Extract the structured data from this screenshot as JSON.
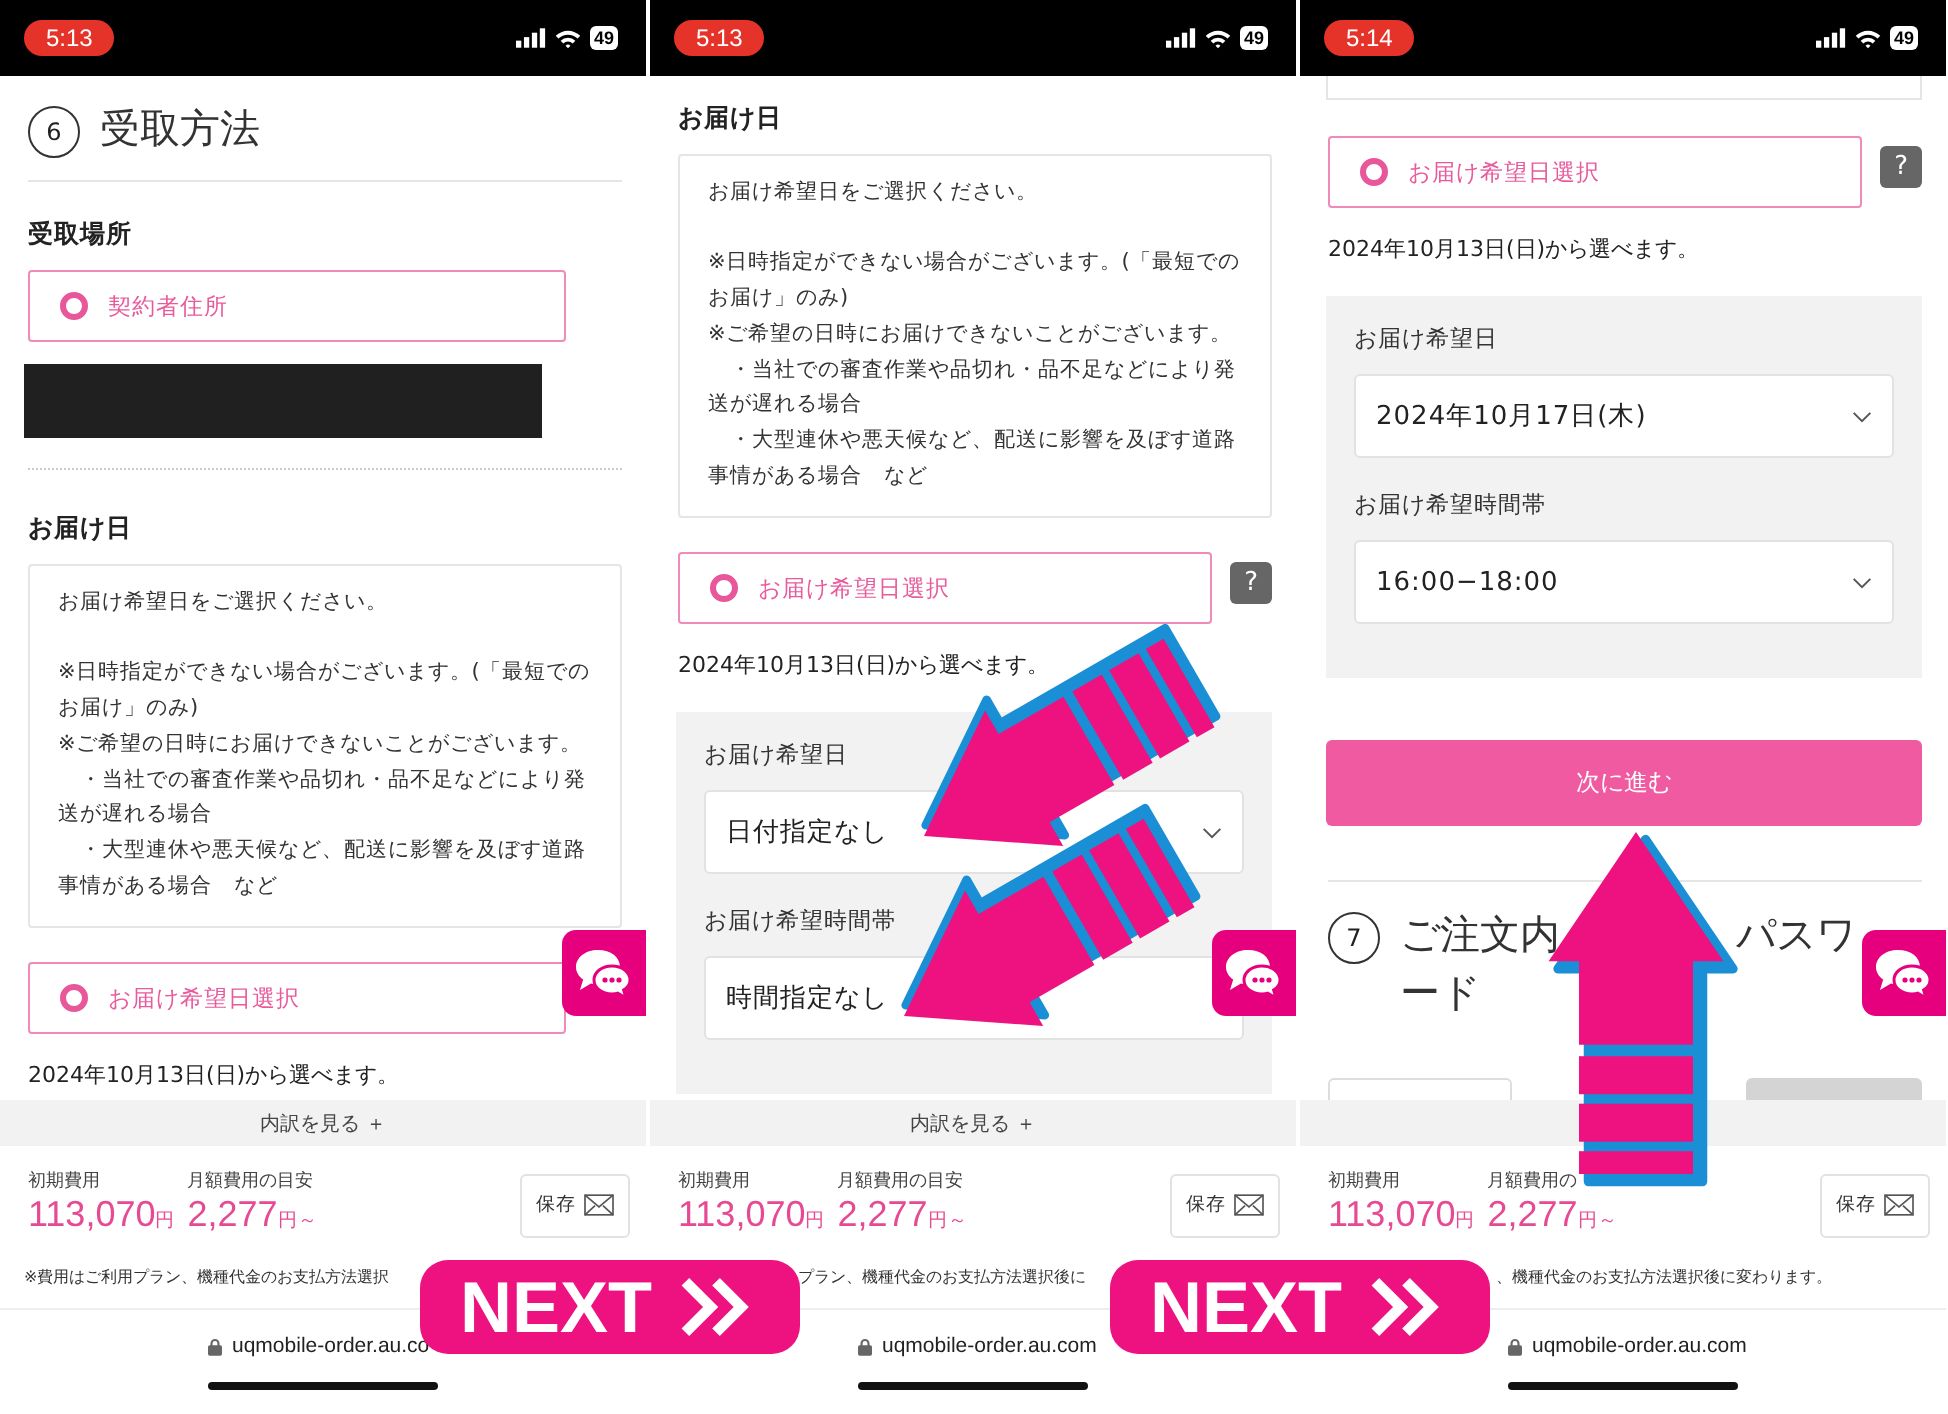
{
  "panels": [
    {
      "time": "5:13",
      "battery": "49",
      "chat_button": true,
      "blocks": [
        {
          "kind": "step",
          "number": "6",
          "title_parts": [
            "受取方法"
          ]
        },
        {
          "kind": "label",
          "text": "受取場所"
        },
        {
          "kind": "radio",
          "text": "契約者住所"
        },
        {
          "kind": "redacted"
        },
        {
          "kind": "divider"
        },
        {
          "kind": "label",
          "text": "お届け日"
        },
        {
          "kind": "notice",
          "paragraphs": [
            [
              "お届け希望日をご選択ください。"
            ],
            [
              "※日時指定ができない場合がございます。(「最短でのお届け」のみ)",
              "※ご希望の日時にお届けできないことがございます。",
              "　・当社での審査作業や品切れ・品不足などにより発送が遅れる場合",
              "　・大型連休や悪天候など、配送に影響を及ぼす道路事情がある場合　など"
            ]
          ]
        },
        {
          "kind": "radio",
          "text": "お届け希望日選択"
        },
        {
          "kind": "note",
          "text": "2024年10月13日(日)から選べます。"
        }
      ],
      "footer": {
        "breakdown": "内訳を見る ＋",
        "fees": [
          {
            "label": "初期費用",
            "amount": "113,070",
            "unit": "円"
          },
          {
            "label": "月額費用の目安",
            "amount": "2,277",
            "unit": "円～"
          }
        ],
        "save": "保存",
        "disclaimer": "※費用はご利用プラン、機種代金のお支払方法選択",
        "url": "uqmobile-order.au.co"
      }
    },
    {
      "time": "5:13",
      "battery": "49",
      "chat_button": true,
      "blocks": [
        {
          "kind": "label",
          "text": "お届け日"
        },
        {
          "kind": "notice",
          "paragraphs": [
            [
              "お届け希望日をご選択ください。"
            ],
            [
              "※日時指定ができない場合がございます。(「最短でのお届け」のみ)",
              "※ご希望の日時にお届けできないことがございます。",
              "　・当社での審査作業や品切れ・品不足などにより発送が遅れる場合",
              "　・大型連休や悪天候など、配送に影響を及ぼす道路事情がある場合　など"
            ]
          ]
        },
        {
          "kind": "radio",
          "text": "お届け希望日選択",
          "help": "?"
        },
        {
          "kind": "note",
          "text": "2024年10月13日(日)から選べます。"
        },
        {
          "kind": "selects",
          "fields": [
            {
              "label": "お届け希望日",
              "value": "日付指定なし",
              "caret": true
            },
            {
              "label": "お届け希望時間帯",
              "value": "時間指定なし",
              "caret": false
            }
          ]
        }
      ],
      "footer": {
        "breakdown": "内訳を見る ＋",
        "fees": [
          {
            "label": "初期費用",
            "amount": "113,070",
            "unit": "円"
          },
          {
            "label": "月額費用の目安",
            "amount": "2,277",
            "unit": "円～"
          }
        ],
        "save": "保存",
        "disclaimer": "プラン、機種代金のお支払方法選択後に",
        "url": "uqmobile-order.au.com"
      }
    },
    {
      "time": "5:14",
      "battery": "49",
      "chat_button": true,
      "blocks": [
        {
          "kind": "box_end"
        },
        {
          "kind": "radio",
          "text": "お届け希望日選択",
          "help": "?"
        },
        {
          "kind": "note",
          "text": "2024年10月13日(日)から選べます。"
        },
        {
          "kind": "selects",
          "fields": [
            {
              "label": "お届け希望日",
              "value": "2024年10月17日(木)",
              "caret": true
            },
            {
              "label": "お届け希望時間帯",
              "value": "16:00−18:00",
              "caret": true
            }
          ]
        },
        {
          "kind": "button",
          "text": "次に進む"
        },
        {
          "kind": "divider"
        },
        {
          "kind": "step",
          "number": "7",
          "title_parts": [
            "ご注文内",
            "パスワ",
            "ード"
          ]
        },
        {
          "kind": "partial_inputs"
        }
      ],
      "footer": {
        "fees": [
          {
            "label": "初期費用",
            "amount": "113,070",
            "unit": "円"
          },
          {
            "label": "月額費用の",
            "amount": "2,277",
            "unit": "円～"
          }
        ],
        "save": "保存",
        "disclaimer": "、機種代金のお支払方法選択後に変わります。",
        "url": "uqmobile-order.au.com"
      }
    }
  ],
  "banners": [
    {
      "text": "NEXT"
    },
    {
      "text": "NEXT"
    }
  ]
}
